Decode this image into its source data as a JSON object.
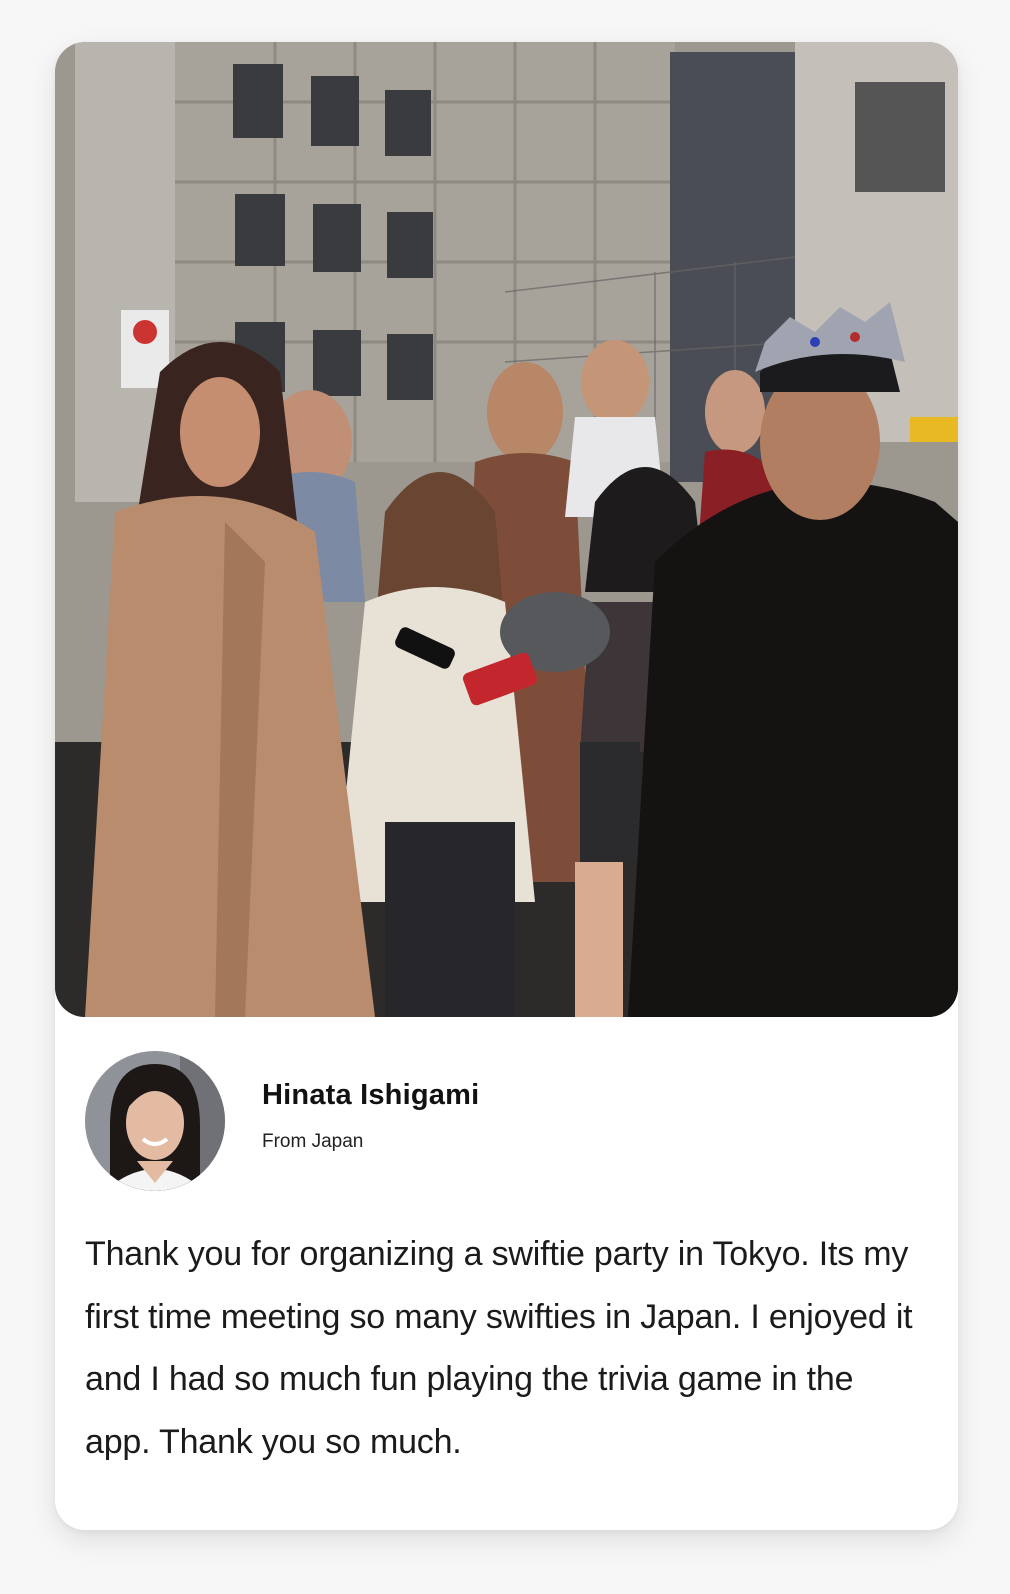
{
  "testimonial": {
    "photo_alt": "Group of fans gathered outdoors being interviewed",
    "avatar_alt": "Hinata Ishigami profile photo",
    "name": "Hinata Ishigami",
    "origin": "From Japan",
    "quote": "Thank you for organizing a swiftie party in Tokyo. Its my first time meeting so many swifties in Japan. I enjoyed it and I had so much fun playing the trivia game in the app. Thank you so much."
  },
  "colors": {
    "page_background": "#f7f7f7",
    "card_background": "#ffffff",
    "text_primary": "#111111"
  }
}
